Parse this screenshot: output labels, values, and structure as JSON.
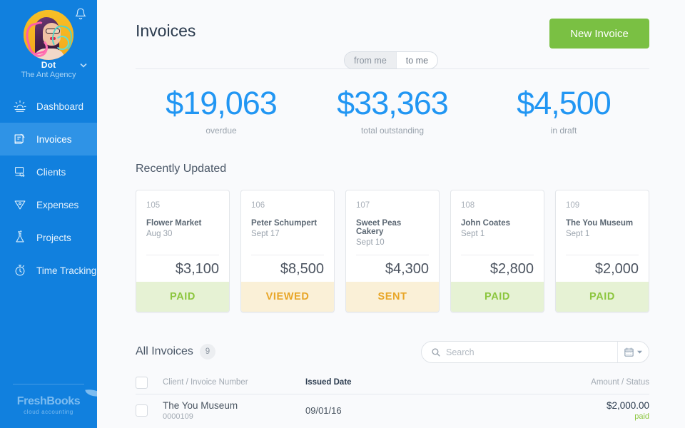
{
  "sidebar": {
    "bell_icon": "bell-icon",
    "user": {
      "name": "Dot",
      "org": "The Ant Agency",
      "caret_icon": "chevron-down-icon",
      "avatar_icon": "avatar"
    },
    "items": [
      {
        "label": "Dashboard",
        "icon": "sunrise-icon",
        "active": false
      },
      {
        "label": "Invoices",
        "icon": "invoice-icon",
        "active": true
      },
      {
        "label": "Clients",
        "icon": "clients-icon",
        "active": false
      },
      {
        "label": "Expenses",
        "icon": "expenses-icon",
        "active": false
      },
      {
        "label": "Projects",
        "icon": "flask-icon",
        "active": false
      },
      {
        "label": "Time Tracking",
        "icon": "stopwatch-icon",
        "active": false
      }
    ],
    "logo": {
      "main": "FreshBooks",
      "sub": "cloud accounting"
    }
  },
  "header": {
    "title": "Invoices",
    "new_invoice_label": "New Invoice",
    "toggle": {
      "left": "from me",
      "right": "to me",
      "selected": "from me"
    }
  },
  "stats": [
    {
      "value": "$19,063",
      "label": "overdue"
    },
    {
      "value": "$33,363",
      "label": "total outstanding"
    },
    {
      "value": "$4,500",
      "label": "in draft"
    }
  ],
  "recently_updated": {
    "title": "Recently Updated",
    "cards": [
      {
        "number": "105",
        "client": "Flower Market",
        "date": "Aug 30",
        "amount": "$3,100",
        "status": "PAID",
        "status_type": "paid"
      },
      {
        "number": "106",
        "client": "Peter Schumpert",
        "date": "Sept 17",
        "amount": "$8,500",
        "status": "VIEWED",
        "status_type": "amber"
      },
      {
        "number": "107",
        "client": "Sweet Peas Cakery",
        "date": "Sept 10",
        "amount": "$4,300",
        "status": "SENT",
        "status_type": "amber"
      },
      {
        "number": "108",
        "client": "John Coates",
        "date": "Sept 1",
        "amount": "$2,800",
        "status": "PAID",
        "status_type": "paid"
      },
      {
        "number": "109",
        "client": "The You Museum",
        "date": "Sept 1",
        "amount": "$2,000",
        "status": "PAID",
        "status_type": "paid"
      }
    ]
  },
  "all_invoices": {
    "title": "All Invoices",
    "count": "9",
    "search": {
      "placeholder": "Search",
      "value": "",
      "search_icon": "search-icon",
      "calendar_icon": "calendar-icon",
      "caret_icon": "caret-down-icon"
    },
    "columns": {
      "client": "Client / Invoice Number",
      "date": "Issued Date",
      "amount": "Amount / Status"
    },
    "rows": [
      {
        "client": "The You Museum",
        "invoice_number": "0000109",
        "issued_date": "09/01/16",
        "amount": "$2,000.00",
        "status": "paid"
      }
    ]
  },
  "colors": {
    "sidebar_blue": "#1180de",
    "sidebar_active": "#2f93e6",
    "accent_green": "#7ac043",
    "stat_blue": "#2196f3",
    "status_paid": "#8cc63e",
    "status_amber": "#e8a628"
  }
}
